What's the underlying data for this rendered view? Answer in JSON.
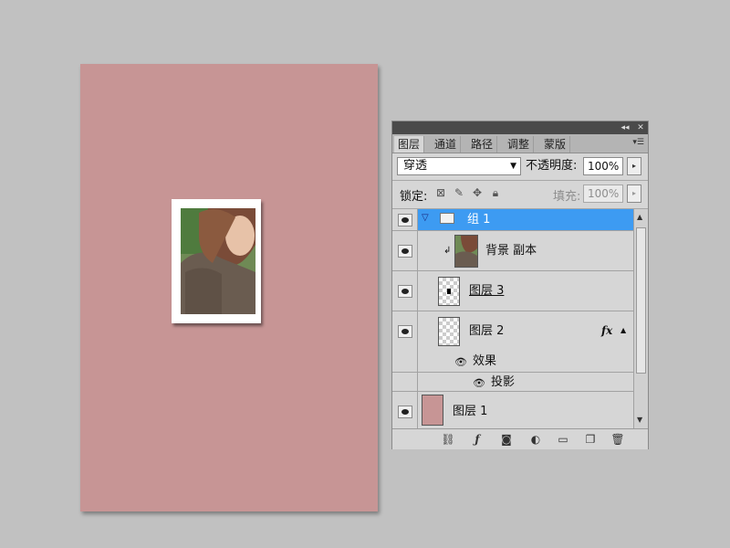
{
  "panel": {
    "tabs": [
      "图层",
      "通道",
      "路径",
      "调整",
      "蒙版"
    ],
    "active_tab": 0,
    "blend_mode": "穿透",
    "opacity_label": "不透明度:",
    "opacity_value": "100%",
    "lock_label": "锁定:",
    "fill_label": "填充:",
    "fill_value": "100%"
  },
  "layers": {
    "group": {
      "name": "组 1"
    },
    "bg_copy": {
      "name": "背景 副本"
    },
    "layer3": {
      "name": "图层 3"
    },
    "layer2": {
      "name": "图层 2",
      "fx": "fx"
    },
    "effects": {
      "label": "效果"
    },
    "shadow": {
      "label": "投影"
    },
    "layer1": {
      "name": "图层 1"
    }
  },
  "colors": {
    "canvas": "#c79595",
    "selection": "#3d9bf2"
  }
}
